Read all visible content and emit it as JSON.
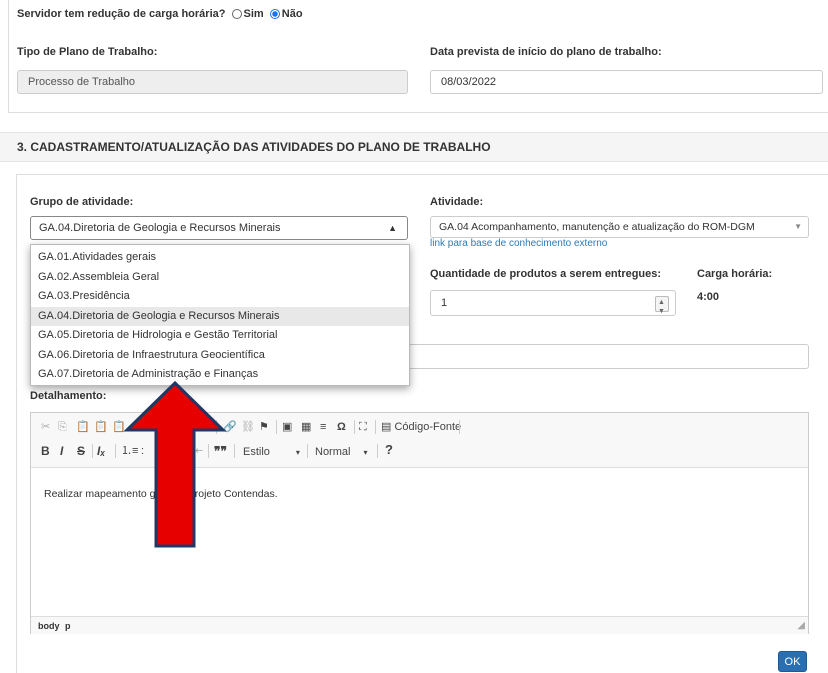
{
  "top": {
    "reduction_question": "Servidor tem redução de carga horária?",
    "radio_yes": "Sim",
    "radio_no": "Não",
    "plan_type_label": "Tipo de Plano de Trabalho:",
    "plan_type_value": "Processo de Trabalho",
    "start_date_label": "Data prevista de início do plano de trabalho:",
    "start_date_value": "08/03/2022"
  },
  "section3": {
    "title": "3. CADASTRAMENTO/ATUALIZAÇÃO DAS ATIVIDADES DO PLANO DE TRABALHO",
    "group_label": "Grupo de atividade:",
    "group_selected": "GA.04.Diretoria de Geologia e Recursos Minerais",
    "group_options": [
      "GA.01.Atividades gerais",
      "GA.02.Assembleia Geral",
      "GA.03.Presidência",
      "GA.04.Diretoria de Geologia e Recursos Minerais",
      "GA.05.Diretoria de Hidrologia e Gestão Territorial",
      "GA.06.Diretoria de Infraestrutura Geocientífica",
      "GA.07.Diretoria de Administração e Finanças"
    ],
    "activity_label": "Atividade:",
    "activity_value": "GA.04 Acompanhamento, manutenção e atualização do ROM-DGM",
    "knowledge_link": "link para base de conhecimento externo",
    "quantity_label": "Quantidade de produtos a serem entregues:",
    "quantity_value": "1",
    "workload_label": "Carga horária:",
    "workload_value": "4:00",
    "detail_label": "Detalhamento:",
    "source_label": "Código-Fonte",
    "style_label": "Estilo",
    "format_label": "Normal",
    "editor_text_a": "Realizar mapeamento geo",
    "editor_text_b": "o Projeto Contendas.",
    "status_path_a": "body",
    "status_path_b": "p",
    "ok_label": "OK"
  },
  "colors": {
    "accent": "#2a6fb2",
    "link": "#2a7ab8",
    "arrow_fill": "#e60000",
    "arrow_stroke": "#1f3864"
  }
}
